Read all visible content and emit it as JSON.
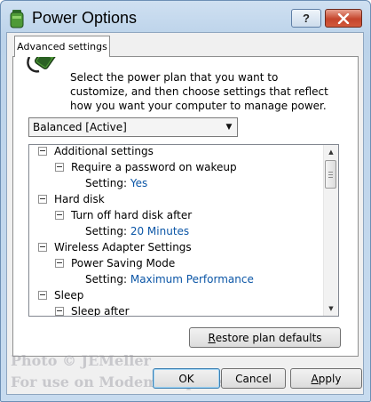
{
  "window": {
    "title": "Power Options",
    "help_label": "?",
    "colors": {
      "accent": "#0a55a6",
      "close": "#c5452c",
      "frame": "#bcd3ea"
    }
  },
  "tab": {
    "label": "Advanced settings"
  },
  "intro": "Select the power plan that you want to customize, and then choose settings that reflect how you want your computer to manage power.",
  "plan_select": {
    "value": "Balanced [Active]"
  },
  "tree": [
    {
      "label": "Additional settings"
    },
    {
      "label": "Require a password on wakeup"
    },
    {
      "label": "Setting:",
      "value": "Yes"
    },
    {
      "label": "Hard disk"
    },
    {
      "label": "Turn off hard disk after"
    },
    {
      "label": "Setting:",
      "value": "20 Minutes"
    },
    {
      "label": "Wireless Adapter Settings"
    },
    {
      "label": "Power Saving Mode"
    },
    {
      "label": "Setting:",
      "value": "Maximum Performance"
    },
    {
      "label": "Sleep"
    },
    {
      "label": "Sleep after"
    }
  ],
  "buttons": {
    "restore": {
      "first": "R",
      "rest": "estore plan defaults"
    },
    "ok": "OK",
    "cancel": "Cancel",
    "apply": {
      "first": "A",
      "rest": "pply"
    }
  },
  "watermark": {
    "line1": "Photo © JEMeller",
    "line2": "For use on ModemHelp.Net"
  }
}
